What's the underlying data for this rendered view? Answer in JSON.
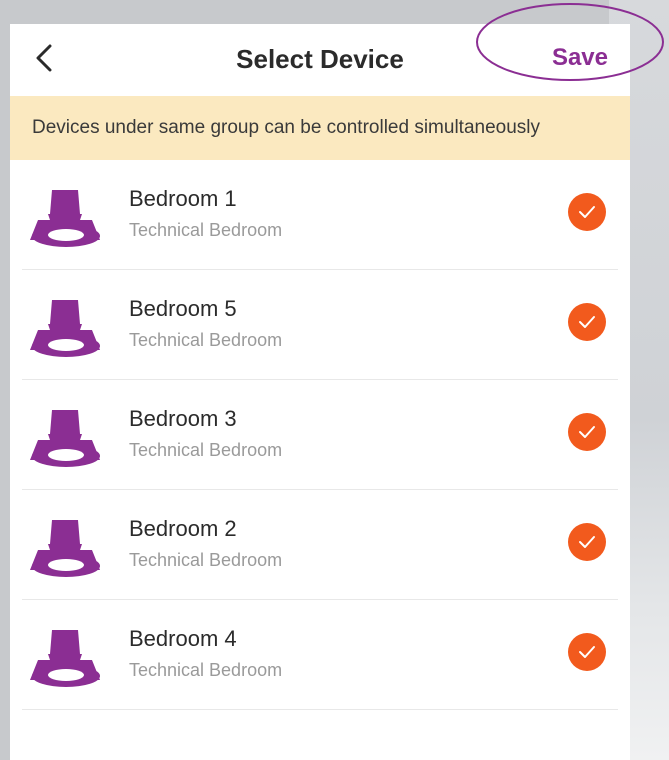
{
  "header": {
    "title": "Select Device",
    "save_label": "Save"
  },
  "notice": {
    "text": "Devices under same group can be controlled simultaneously"
  },
  "colors": {
    "accent": "#8b2e93",
    "check": "#f25a1d",
    "notice_bg": "#fbe9c0"
  },
  "devices": [
    {
      "name": "Bedroom 1",
      "room": "Technical Bedroom",
      "selected": true,
      "icon": "downlight-icon"
    },
    {
      "name": "Bedroom 5",
      "room": "Technical Bedroom",
      "selected": true,
      "icon": "downlight-icon"
    },
    {
      "name": "Bedroom 3",
      "room": "Technical Bedroom",
      "selected": true,
      "icon": "downlight-icon"
    },
    {
      "name": "Bedroom 2",
      "room": "Technical Bedroom",
      "selected": true,
      "icon": "downlight-icon"
    },
    {
      "name": "Bedroom 4",
      "room": "Technical Bedroom",
      "selected": true,
      "icon": "downlight-icon"
    }
  ]
}
